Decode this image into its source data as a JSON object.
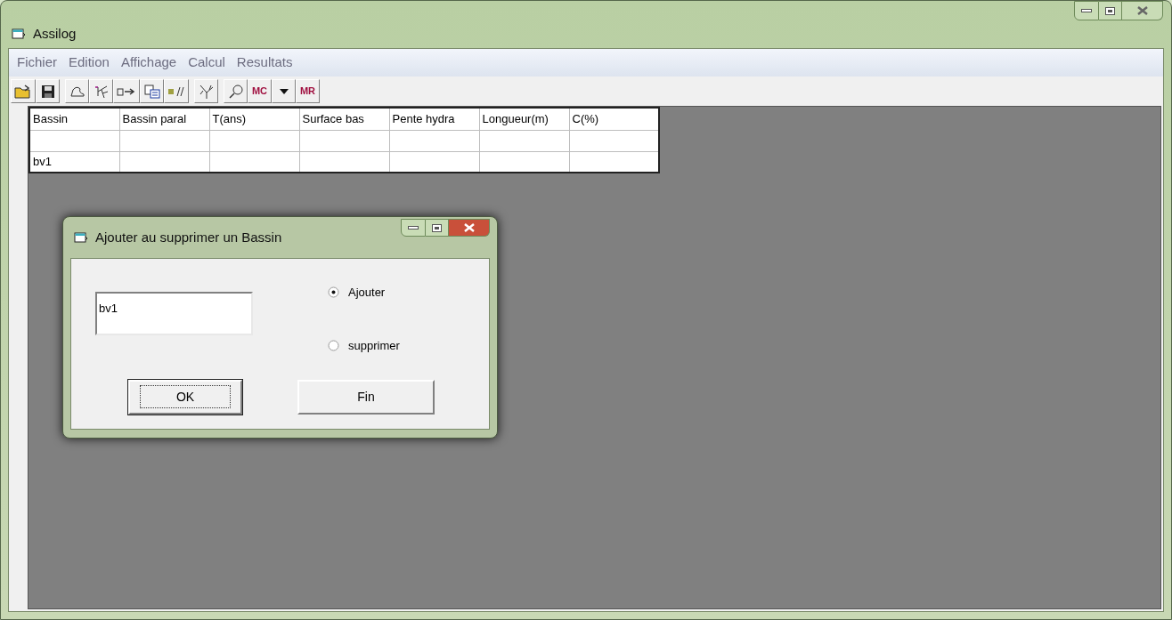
{
  "window": {
    "title": "Assilog"
  },
  "menu": [
    "Fichier",
    "Edition",
    "Affichage",
    "Calcul",
    "Resultats"
  ],
  "toolbar_text_buttons": [
    "MC",
    "MR"
  ],
  "table": {
    "columns": [
      "Bassin",
      "Bassin paral",
      "T(ans)",
      "Surface bas",
      "Pente hydra",
      "Longueur(m)",
      "C(%)"
    ],
    "rows": [
      {
        "cells": []
      },
      {
        "cells": [
          "bv1"
        ]
      }
    ]
  },
  "dialog": {
    "title": "Ajouter au supprimer un Bassin",
    "field_value": "bv1",
    "radios": [
      {
        "label": "Ajouter",
        "selected": true
      },
      {
        "label": "supprimer",
        "selected": false
      }
    ],
    "buttons": [
      {
        "label": "OK",
        "focused": true
      },
      {
        "label": "Fin",
        "focused": false
      }
    ]
  }
}
